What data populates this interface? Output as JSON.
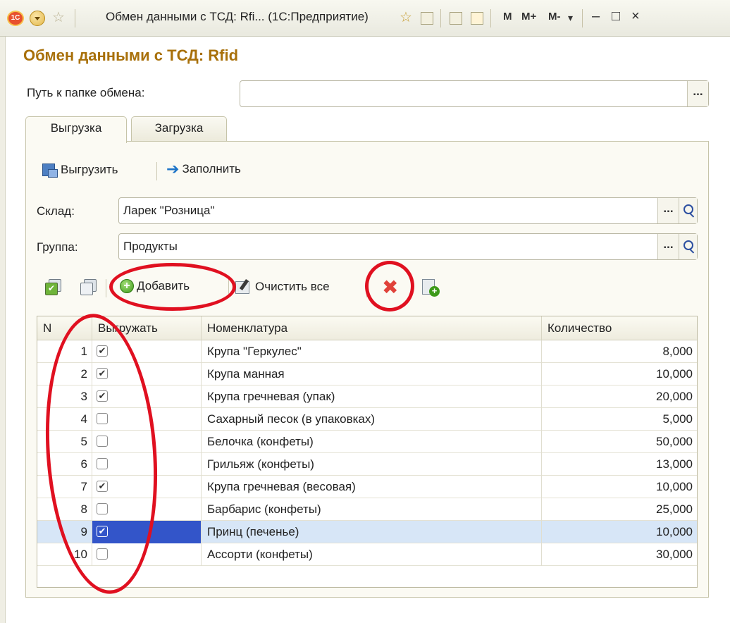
{
  "window": {
    "title": "Обмен данными с ТСД: Rfi... (1С:Предприятие)",
    "logo": "1С",
    "memory_buttons": [
      "M",
      "M+",
      "M-"
    ]
  },
  "form": {
    "title": "Обмен данными с ТСД: Rfid",
    "exchange_folder_label": "Путь к папке обмена:",
    "exchange_folder_value": "",
    "dots": "..."
  },
  "tabs": [
    {
      "label": "Выгрузка",
      "active": true
    },
    {
      "label": "Загрузка",
      "active": false
    }
  ],
  "toolbar": {
    "export_label": "Выгрузить",
    "fill_label": "Заполнить"
  },
  "warehouse": {
    "label": "Склад:",
    "value": "Ларек \"Розница\""
  },
  "group": {
    "label": "Группа:",
    "value": "Продукты"
  },
  "table_toolbar": {
    "add_label": "Добавить",
    "clear_all_label": "Очистить все"
  },
  "table": {
    "columns": [
      "N",
      "Выгружать",
      "Номенклатура",
      "Количество"
    ],
    "rows": [
      {
        "n": "1",
        "checked": true,
        "name": "Крупа \"Геркулес\"",
        "qty": "8,000",
        "selected": false
      },
      {
        "n": "2",
        "checked": true,
        "name": "Крупа манная",
        "qty": "10,000",
        "selected": false
      },
      {
        "n": "3",
        "checked": true,
        "name": "Крупа гречневая (упак)",
        "qty": "20,000",
        "selected": false
      },
      {
        "n": "4",
        "checked": false,
        "name": "Сахарный песок (в упаковках)",
        "qty": "5,000",
        "selected": false
      },
      {
        "n": "5",
        "checked": false,
        "name": "Белочка (конфеты)",
        "qty": "50,000",
        "selected": false
      },
      {
        "n": "6",
        "checked": false,
        "name": "Грильяж (конфеты)",
        "qty": "13,000",
        "selected": false
      },
      {
        "n": "7",
        "checked": true,
        "name": "Крупа гречневая (весовая)",
        "qty": "10,000",
        "selected": false
      },
      {
        "n": "8",
        "checked": false,
        "name": "Барбарис (конфеты)",
        "qty": "25,000",
        "selected": false
      },
      {
        "n": "9",
        "checked": true,
        "name": "Принц (печенье)",
        "qty": "10,000",
        "selected": true
      },
      {
        "n": "10",
        "checked": false,
        "name": "Ассорти (конфеты)",
        "qty": "30,000",
        "selected": false
      }
    ]
  },
  "colors": {
    "form_title": "#a8700a",
    "annotation": "#e01020",
    "selected_row": "#d7e6f7"
  }
}
